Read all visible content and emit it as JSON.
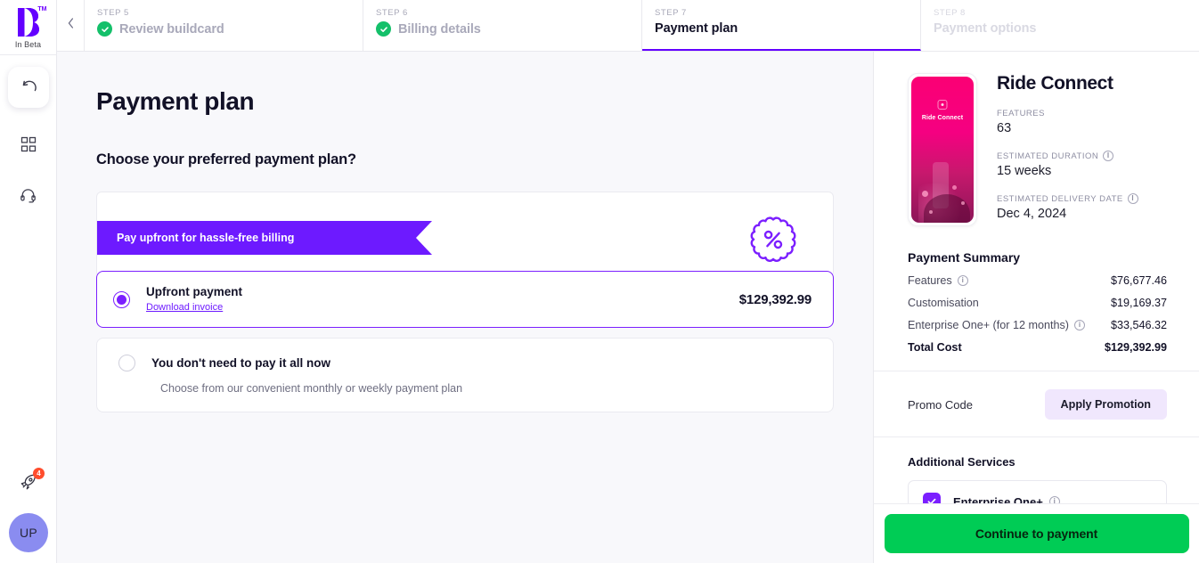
{
  "brand": {
    "logo_letter": "B",
    "trademark": "TM",
    "beta_label": "In Beta",
    "accent_color": "#6300ff"
  },
  "rail": {
    "undo_icon": "undo-icon",
    "dashboard_icon": "grid-icon",
    "support_icon": "headset-icon",
    "rocket_icon": "rocket-icon",
    "rocket_badge": "4",
    "avatar_initials": "UP"
  },
  "stepper": {
    "back_icon": "chevron-left-icon",
    "steps": [
      {
        "num": "STEP 5",
        "label": "Review buildcard",
        "state": "done"
      },
      {
        "num": "STEP 6",
        "label": "Billing details",
        "state": "done"
      },
      {
        "num": "STEP 7",
        "label": "Payment plan",
        "state": "active"
      },
      {
        "num": "STEP 8",
        "label": "Payment options",
        "state": "upcoming"
      }
    ]
  },
  "main": {
    "title": "Payment plan",
    "question": "Choose your preferred payment plan?",
    "ribbon_text": "Pay upfront for hassle-free billing",
    "discount_icon": "percent-badge-icon",
    "options": [
      {
        "title": "Upfront payment",
        "link": "Download invoice",
        "price": "$129,392.99",
        "selected": true
      },
      {
        "title": "You don't need to pay it all now",
        "subtitle": "Choose from our convenient monthly or weekly payment plan",
        "selected": false
      }
    ]
  },
  "summary_panel": {
    "product": {
      "name": "Ride Connect",
      "phone_caption": "Ride Connect"
    },
    "meta": [
      {
        "label": "FEATURES",
        "value": "63",
        "info": false
      },
      {
        "label": "ESTIMATED DURATION",
        "value": "15 weeks",
        "info": true
      },
      {
        "label": "ESTIMATED DELIVERY DATE",
        "value": "Dec 4, 2024",
        "info": true
      }
    ],
    "payment_summary_title": "Payment Summary",
    "lines": [
      {
        "label": "Features",
        "value": "$76,677.46",
        "info": true,
        "total": false
      },
      {
        "label": "Customisation",
        "value": "$19,169.37",
        "info": false,
        "total": false
      },
      {
        "label": "Enterprise One+ (for 12 months)",
        "value": "$33,546.32",
        "info": true,
        "total": false
      },
      {
        "label": "Total Cost",
        "value": "$129,392.99",
        "info": false,
        "total": true
      }
    ],
    "promo_label": "Promo Code",
    "promo_button": "Apply Promotion",
    "additional_title": "Additional Services",
    "services": [
      {
        "label": "Enterprise One+",
        "checked": true,
        "info": true
      }
    ]
  },
  "cta": {
    "label": "Continue to payment",
    "color": "#00cc55"
  }
}
